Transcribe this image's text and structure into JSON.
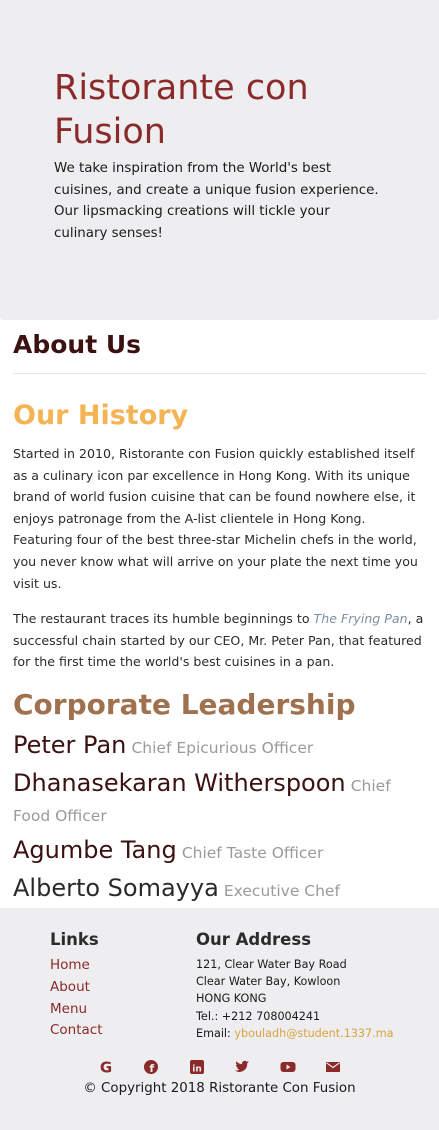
{
  "hero": {
    "title": "Ristorante con Fusion",
    "description": "We take inspiration from the World's best cuisines, and create a unique fusion experience. Our lipsmacking creations will tickle your culinary senses!"
  },
  "about": {
    "title": "About Us",
    "history_title": "Our History",
    "history_paragraph_1": "Started in 2010, Ristorante con Fusion quickly established itself as a culinary icon par excellence in Hong Kong. With its unique brand of world fusion cuisine that can be found nowhere else, it enjoys patronage from the A-list clientele in Hong Kong. Featuring four of the best three-star Michelin chefs in the world, you never know what will arrive on your plate the next time you visit us.",
    "history_paragraph_2_before": "The restaurant traces its humble beginnings to ",
    "history_paragraph_2_emphasis": "The Frying Pan",
    "history_paragraph_2_after": ", a successful chain started by our CEO, Mr. Peter Pan, that featured for the first time the world's best cuisines in a pan."
  },
  "leadership": {
    "title": "Corporate Leadership",
    "leaders": [
      {
        "name": "Peter Pan",
        "role": "Chief Epicurious Officer"
      },
      {
        "name": "Dhanasekaran Witherspoon",
        "role": "Chief Food Officer"
      },
      {
        "name": "Agumbe Tang",
        "role": "Chief Taste Officer"
      },
      {
        "name": "Alberto Somayya",
        "role": "Executive Chef"
      }
    ]
  },
  "footer": {
    "links_title": "Links",
    "links": [
      "Home",
      "About",
      "Menu",
      "Contact"
    ],
    "address_title": "Our Address",
    "address_lines": [
      "121, Clear Water Bay Road",
      "Clear Water Bay, Kowloon",
      "HONG KONG",
      "Tel.: +212 708004241"
    ],
    "email_label": "Email: ",
    "email": "ybouladh@student.1337.ma",
    "socials": [
      "google-icon",
      "facebook-icon",
      "linkedin-icon",
      "twitter-icon",
      "youtube-icon",
      "mail-icon"
    ],
    "social_color": "#8b2a2a",
    "copyright": "© Copyright 2018 Ristorante Con Fusion"
  }
}
